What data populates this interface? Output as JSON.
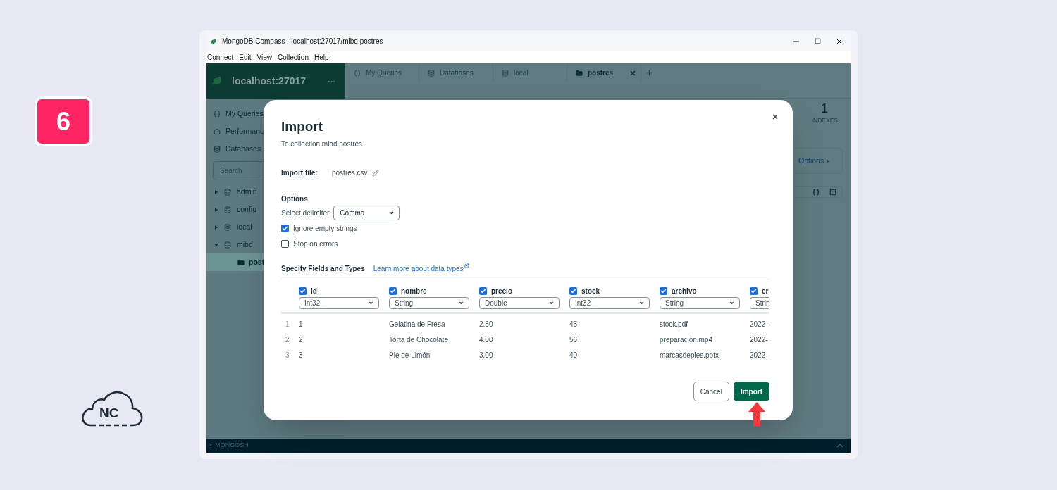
{
  "badge": "6",
  "logo": "NC",
  "window": {
    "title": "MongoDB Compass - localhost:27017/mibd.postres",
    "menu": [
      "Connect",
      "Edit",
      "View",
      "Collection",
      "Help"
    ]
  },
  "sidebar": {
    "connection": "localhost:27017",
    "more": "···",
    "nav": [
      {
        "kind": "queries",
        "label": "My Queries"
      },
      {
        "kind": "performance",
        "label": "Performanc"
      },
      {
        "kind": "databases",
        "label": "Databases"
      }
    ],
    "search": {
      "placeholder": "Search"
    },
    "tree": [
      {
        "label": "admin",
        "expanded": false,
        "selected": false
      },
      {
        "label": "config",
        "expanded": false,
        "selected": false
      },
      {
        "label": "local",
        "expanded": false,
        "selected": false
      },
      {
        "label": "mibd",
        "expanded": true,
        "selected": false,
        "children": [
          {
            "label": "post",
            "selected": true
          }
        ]
      }
    ]
  },
  "tabs": [
    {
      "kind": "queries",
      "label": "My Queries",
      "selected": false
    },
    {
      "kind": "databases",
      "label": "Databases",
      "selected": false
    },
    {
      "kind": "database",
      "label": "local",
      "selected": false
    },
    {
      "kind": "collection",
      "label": "postres",
      "selected": true
    }
  ],
  "stats": [
    {
      "value": "1",
      "label": "INDEXES"
    }
  ],
  "options_button": "Options",
  "mongosh": ">_MONGOSH",
  "dialog": {
    "title": "Import",
    "subtitle": "To collection mibd.postres",
    "import_file": {
      "label": "Import file:",
      "value": "postres.csv"
    },
    "options": {
      "heading": "Options",
      "delimiter": {
        "label": "Select delimiter",
        "value": "Comma"
      },
      "checkboxes": [
        {
          "label": "Ignore empty strings",
          "checked": true
        },
        {
          "label": "Stop on errors",
          "checked": false
        }
      ]
    },
    "fields": {
      "heading": "Specify Fields and Types",
      "link": "Learn more about data types",
      "columns": [
        {
          "name": "id",
          "checked": true,
          "type": "Int32"
        },
        {
          "name": "nombre",
          "checked": true,
          "type": "String"
        },
        {
          "name": "precio",
          "checked": true,
          "type": "Double"
        },
        {
          "name": "stock",
          "checked": true,
          "type": "Int32"
        },
        {
          "name": "archivo",
          "checked": true,
          "type": "String"
        },
        {
          "name": "cr",
          "checked": true,
          "type": "Strin"
        }
      ],
      "rows": [
        {
          "index": "1",
          "cells": [
            "1",
            "Gelatina de Fresa",
            "2.50",
            "45",
            "stock.pdf",
            "2022-"
          ]
        },
        {
          "index": "2",
          "cells": [
            "2",
            "Torta de Chocolate",
            "4.00",
            "56",
            "preparacion.mp4",
            "2022-"
          ]
        },
        {
          "index": "3",
          "cells": [
            "3",
            "Pie de Limón",
            "3.00",
            "40",
            "marcasdepies.pptx",
            "2022-"
          ]
        }
      ]
    },
    "buttons": [
      {
        "kind": "secondary",
        "label": "Cancel"
      },
      {
        "kind": "primary",
        "label": "Import"
      }
    ]
  }
}
